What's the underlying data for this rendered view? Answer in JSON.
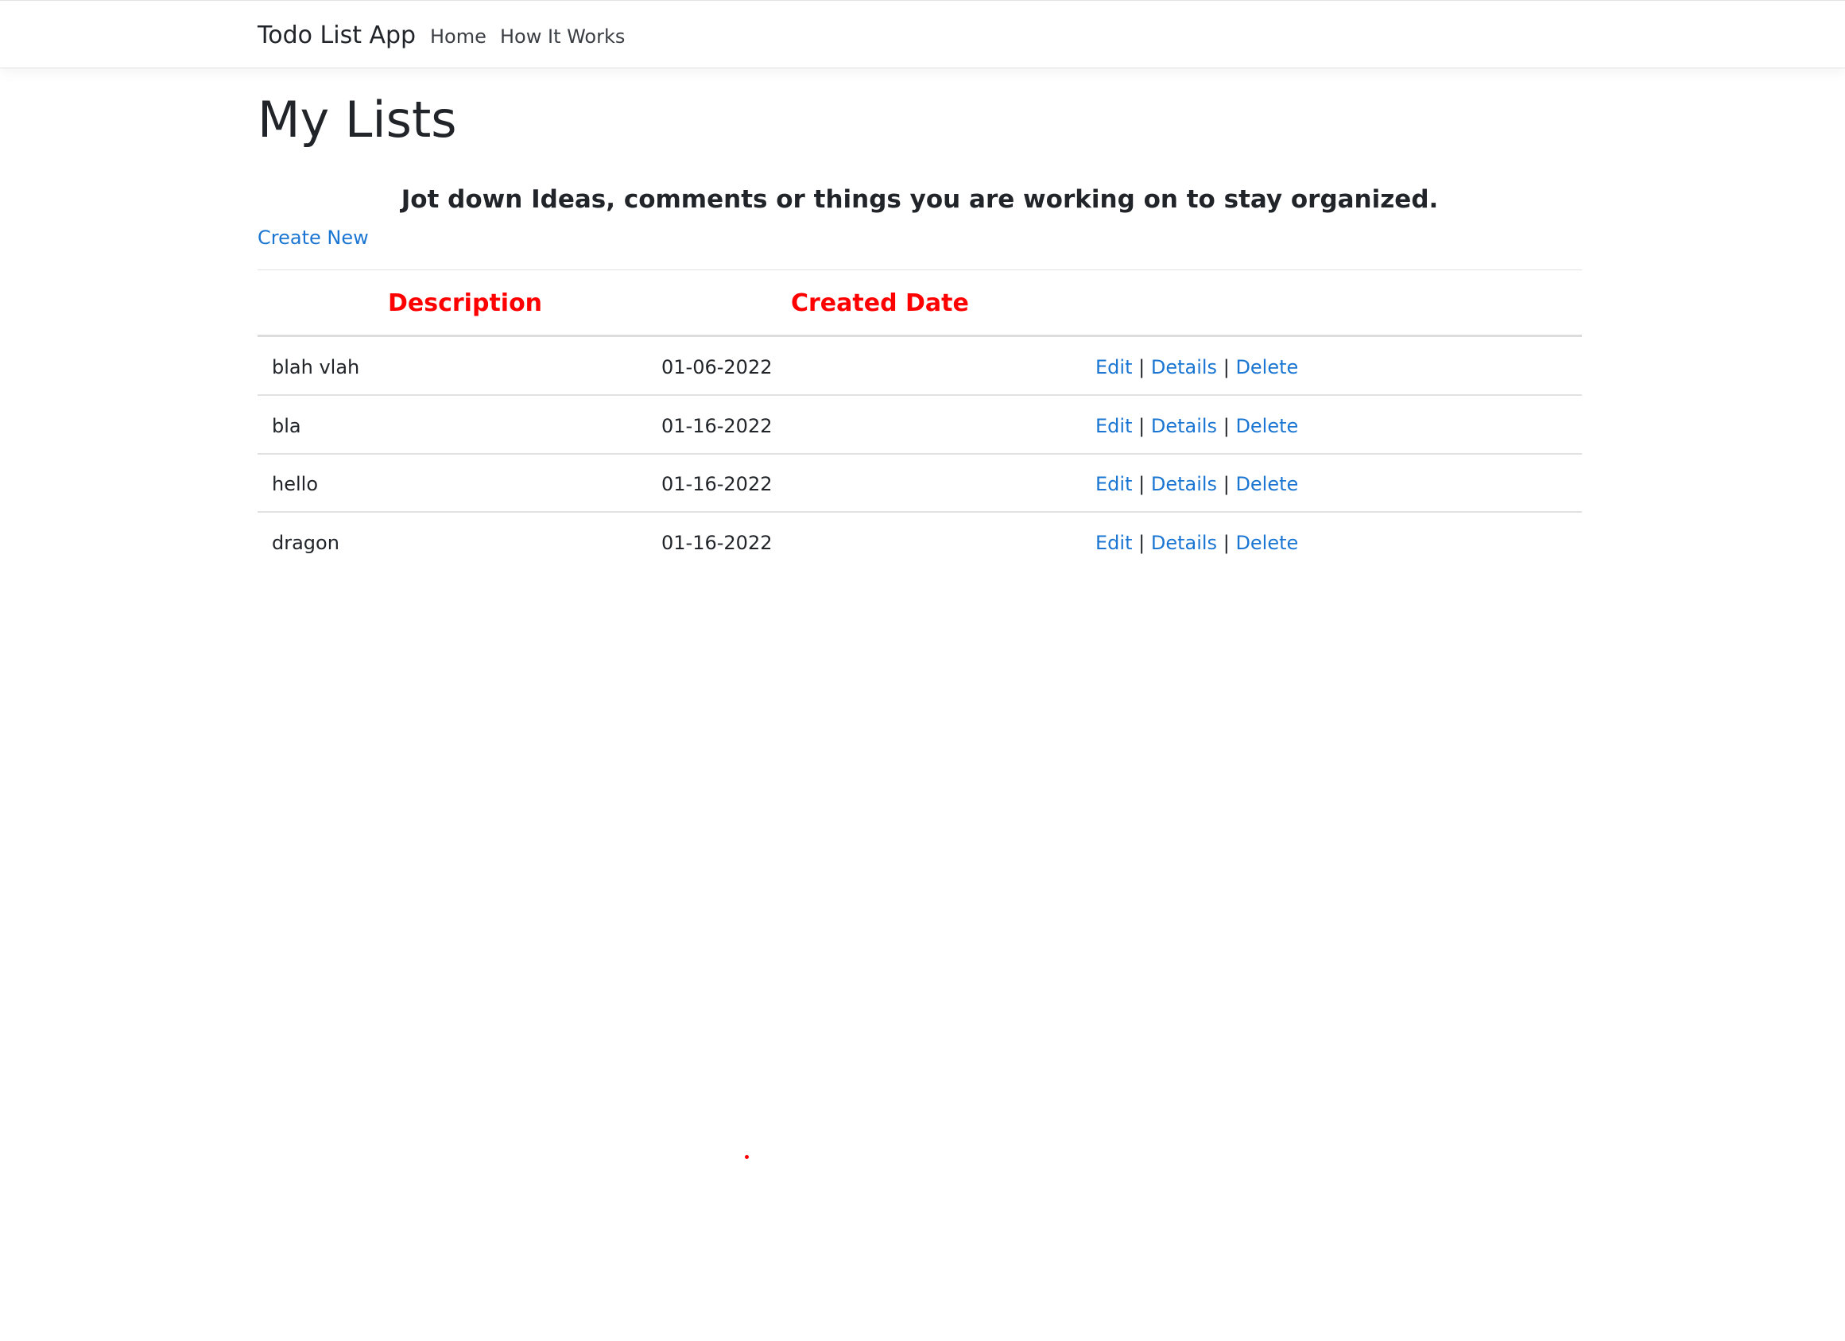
{
  "navbar": {
    "brand": "Todo List App",
    "links": [
      {
        "label": "Home"
      },
      {
        "label": "How It Works"
      }
    ]
  },
  "main": {
    "title": "My Lists",
    "subtitle": "Jot down Ideas, comments or things you are working on to stay organized.",
    "create_new_label": "Create New",
    "table": {
      "headers": {
        "description": "Description",
        "created_date": "Created Date"
      },
      "rows": [
        {
          "description": "blah vlah",
          "created_date": "01-06-2022"
        },
        {
          "description": "bla",
          "created_date": "01-16-2022"
        },
        {
          "description": "hello",
          "created_date": "01-16-2022"
        },
        {
          "description": "dragon",
          "created_date": "01-16-2022"
        }
      ],
      "actions": {
        "edit": "Edit",
        "details": "Details",
        "delete": "Delete",
        "separator": "|"
      }
    }
  },
  "colors": {
    "link": "#1a76d2",
    "header_text": "#ff0000",
    "body_text": "#212529"
  }
}
